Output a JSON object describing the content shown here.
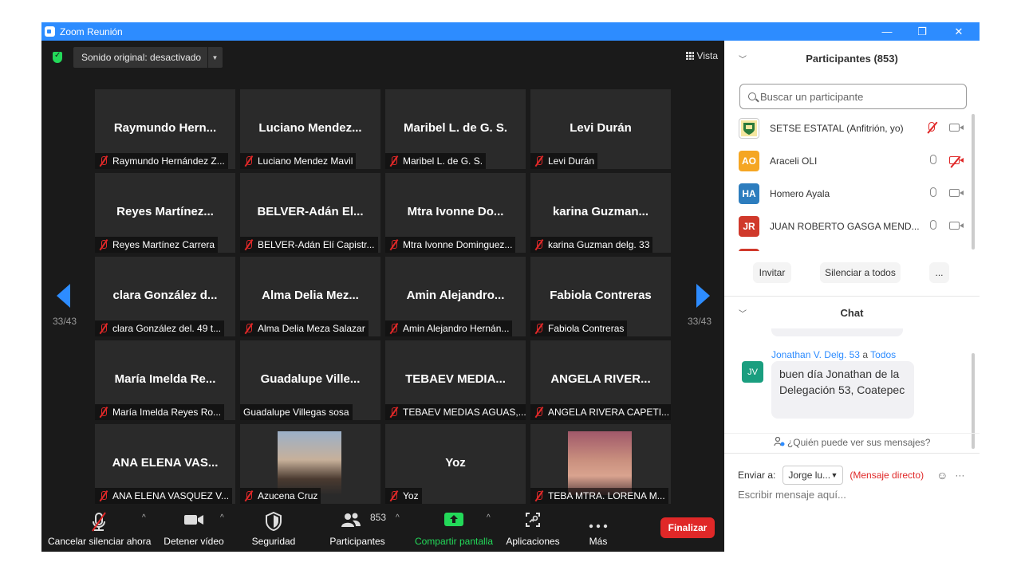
{
  "window": {
    "title": "Zoom Reunión"
  },
  "meeting": {
    "sound_label": "Sonido original: desactivado",
    "view_label": "Vista",
    "page_left": "33/43",
    "page_right": "33/43",
    "tiles": [
      {
        "big": "Raymundo  Hern...",
        "label": "Raymundo Hernández Z..."
      },
      {
        "big": "Luciano  Mendez...",
        "label": "Luciano Mendez Mavil"
      },
      {
        "big": "Maribel L. de G. S.",
        "label": "Maribel L. de G. S."
      },
      {
        "big": "Levi Durán",
        "label": "Levi Durán"
      },
      {
        "big": "Reyes  Martínez...",
        "label": "Reyes Martínez Carrera"
      },
      {
        "big": "BELVER-Adán  El...",
        "label": "BELVER-Adán Elí Capistr..."
      },
      {
        "big": "Mtra Ivonne  Do...",
        "label": "Mtra Ivonne Dominguez..."
      },
      {
        "big": "karina  Guzman...",
        "label": "karina Guzman delg. 33"
      },
      {
        "big": "clara  González  d...",
        "label": "clara González del. 49 t..."
      },
      {
        "big": "Alma  Delia  Mez...",
        "label": "Alma Delia Meza Salazar"
      },
      {
        "big": "Amin  Alejandro...",
        "label": "Amin Alejandro Hernán..."
      },
      {
        "big": "Fabiola Contreras",
        "label": "Fabiola Contreras"
      },
      {
        "big": "María  Imelda  Re...",
        "label": "María Imelda Reyes Ro..."
      },
      {
        "big": "Guadalupe  Ville...",
        "label": "Guadalupe Villegas sosa"
      },
      {
        "big": "TEBAEV  MEDIA...",
        "label": "TEBAEV MEDIAS AGUAS,..."
      },
      {
        "big": "ANGELA  RIVER...",
        "label": "ANGELA RIVERA CAPETI..."
      },
      {
        "big": "ANA  ELENA  VAS...",
        "label": "ANA ELENA VASQUEZ V..."
      },
      {
        "big": "",
        "label": "Azucena Cruz"
      },
      {
        "big": "Yoz",
        "label": "Yoz"
      },
      {
        "big": "",
        "label": "TEBA MTRA. LORENA M..."
      }
    ]
  },
  "toolbar": {
    "unmute": "Cancelar silenciar ahora",
    "video": "Detener vídeo",
    "security": "Seguridad",
    "participants": "Participantes",
    "participants_count": "853",
    "share": "Compartir pantalla",
    "apps": "Aplicaciones",
    "more": "Más",
    "end": "Finalizar"
  },
  "participants_panel": {
    "title": "Participantes (853)",
    "search_placeholder": "Buscar un participante",
    "people": [
      {
        "initials": "",
        "name": "SETSE ESTATAL (Anfitrión, yo)",
        "color": "#2a7a3b"
      },
      {
        "initials": "AO",
        "name": "Araceli OLI",
        "color": "#f5a623"
      },
      {
        "initials": "HA",
        "name": "Homero Ayala",
        "color": "#2d7dbe"
      },
      {
        "initials": "JR",
        "name": "JUAN ROBERTO GASGA   MEND...",
        "color": "#d0392b"
      }
    ],
    "invite": "Invitar",
    "mute_all": "Silenciar a todos",
    "more": "..."
  },
  "chat_panel": {
    "title": "Chat",
    "sender": "Jonathan V. Delg. 53",
    "to_word": "a",
    "to": "Todos",
    "avatar_initials": "JV",
    "message": "buen día Jonathan de la Delegación 53, Coatepec",
    "who_can_see": "¿Quién puede ver sus mensajes?",
    "send_to_label": "Enviar a:",
    "recipient": "Jorge lu...",
    "direct_label": "(Mensaje directo)",
    "input_placeholder": "Escribir mensaje aquí..."
  }
}
